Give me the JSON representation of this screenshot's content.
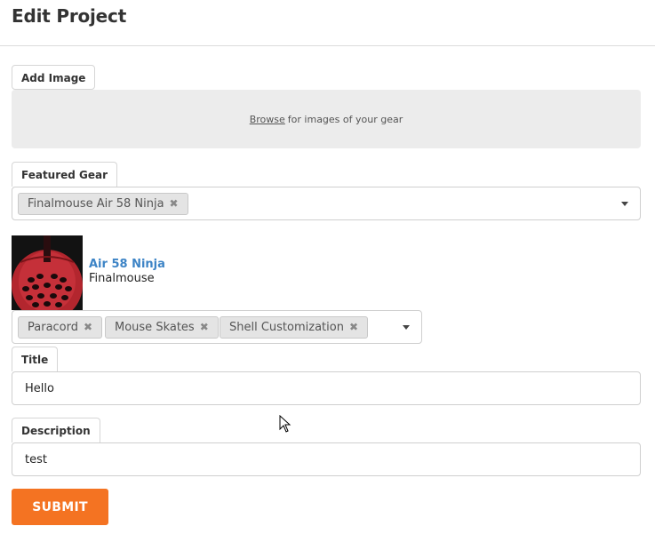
{
  "header": {
    "title": "Edit Project"
  },
  "image_section": {
    "label": "Add Image",
    "browse_link": "Browse",
    "hint": "for images of your gear"
  },
  "featured_gear": {
    "label": "Featured Gear",
    "selected": [
      {
        "label": "Finalmouse Air 58 Ninja"
      }
    ]
  },
  "product": {
    "name": "Air 58 Ninja",
    "brand": "Finalmouse",
    "mods": [
      {
        "label": "Paracord"
      },
      {
        "label": "Mouse Skates"
      },
      {
        "label": "Shell Customization"
      }
    ]
  },
  "title_field": {
    "label": "Title",
    "value": "Hello"
  },
  "description_field": {
    "label": "Description",
    "value": "test"
  },
  "submit": {
    "label": "SUBMIT"
  },
  "colors": {
    "accent": "#f47322",
    "link": "#3d84c6"
  }
}
